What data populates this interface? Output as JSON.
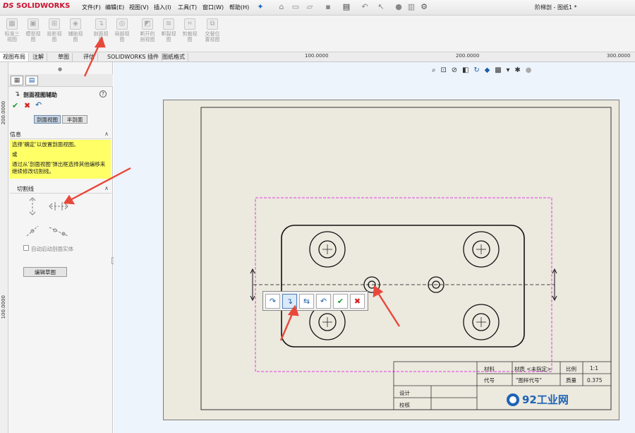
{
  "app": {
    "logo_ds": "DS",
    "logo_name": "SOLIDWORKS",
    "document_title": "阶梯剖 - 图纸1 *"
  },
  "menu": [
    {
      "label": "文件(F)"
    },
    {
      "label": "编辑(E)"
    },
    {
      "label": "视图(V)"
    },
    {
      "label": "插入(I)"
    },
    {
      "label": "工具(T)"
    },
    {
      "label": "窗口(W)"
    },
    {
      "label": "帮助(H)"
    }
  ],
  "ribbon": {
    "buttons": [
      {
        "label": "标准三\n视图"
      },
      {
        "label": "模型视\n图"
      },
      {
        "label": "投影视\n图"
      },
      {
        "label": "辅助视\n图"
      },
      {
        "label": "剖面视\n图"
      },
      {
        "label": "局部视\n图"
      },
      {
        "label": "断开的\n剖视图"
      },
      {
        "label": "断裂视\n图"
      },
      {
        "label": "剪裁视\n图"
      },
      {
        "label": "交替位\n置视图"
      }
    ]
  },
  "tabs": [
    {
      "label": "视图布局"
    },
    {
      "label": "注解"
    },
    {
      "label": "草图"
    },
    {
      "label": "评估"
    },
    {
      "label": "SOLIDWORKS 插件"
    },
    {
      "label": "图纸格式"
    }
  ],
  "rulers": {
    "h": [
      "100.0000",
      "200.0000",
      "300.0000"
    ],
    "v": [
      "200.0000",
      "100.0000"
    ]
  },
  "panel": {
    "title": "剖面视图辅助",
    "help": "?",
    "mode_tabs": [
      "剖面视图",
      "半剖面"
    ],
    "info_section": "信息",
    "info_text_1": "选择‘确定’以放置剖面视图。",
    "info_or": "或",
    "info_text_2": "通过从‘剖面视图’弹出框选择其他编移来继续修改切割线。",
    "cutline_section": "切割线",
    "auto_start_checkbox": "自动启动剖面实体",
    "edit_sketch_button": "编辑草图"
  },
  "popup_toolbar": {
    "icons": [
      "arc-offset-icon",
      "single-offset-icon",
      "notch-offset-icon",
      "undo-icon",
      "confirm-icon",
      "cancel-icon"
    ]
  },
  "title_block": {
    "material_label": "材料",
    "material_value": "材质 <未指定>",
    "scale_label": "比例",
    "scale_value": "1:1",
    "code_label": "代号",
    "code_value": "\"图样代号\"",
    "mass_label": "质量",
    "mass_value": "0.375",
    "design_label": "设计",
    "check_label": "校核",
    "brand_text": "92工业网"
  },
  "colors": {
    "accent_red": "#e8483a",
    "magenta_frame": "#e040e0",
    "info_yellow": "#ffff66",
    "brand_blue": "#1d63b5"
  }
}
